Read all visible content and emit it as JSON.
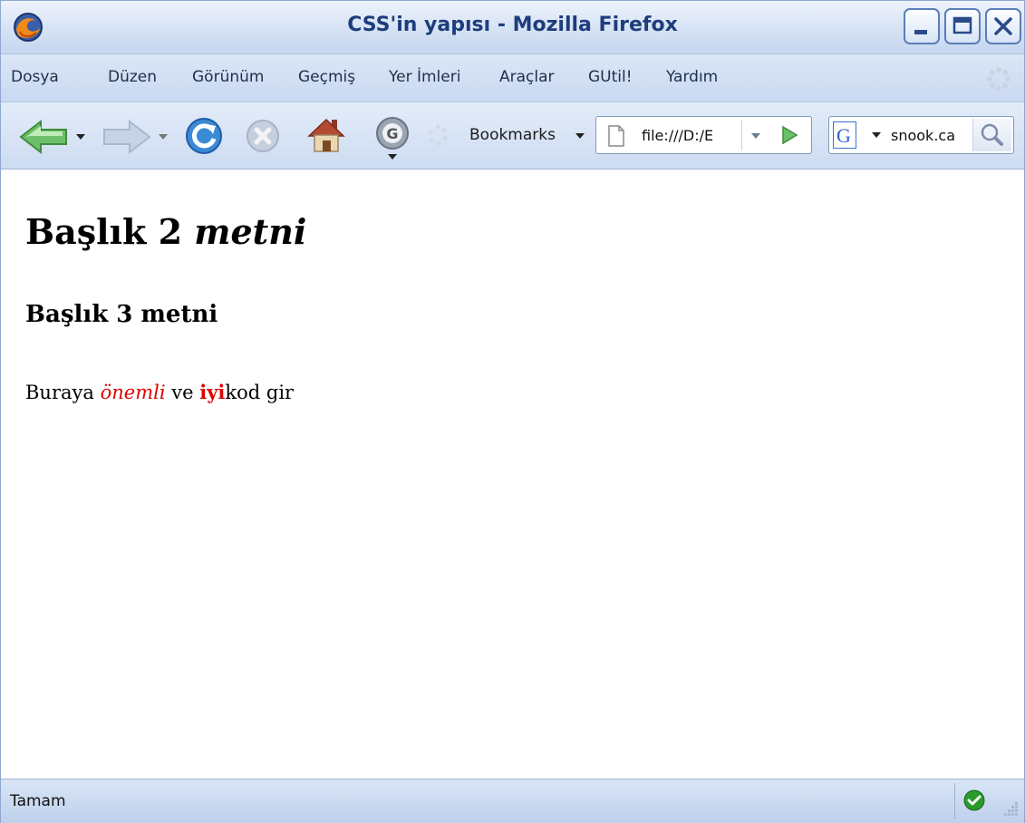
{
  "window": {
    "title": "CSS'in yapısı - Mozilla Firefox",
    "controls": [
      "minimize",
      "maximize",
      "close"
    ]
  },
  "menu": {
    "items": [
      {
        "label": "Dosya"
      },
      {
        "label": "Düzen"
      },
      {
        "label": "Görünüm"
      },
      {
        "label": "Geçmiş"
      },
      {
        "label": "Yer İmleri"
      },
      {
        "label": "Araçlar"
      },
      {
        "label": "GUtil!"
      },
      {
        "label": "Yardım"
      }
    ]
  },
  "toolbar": {
    "bookmarks_label": "Bookmarks",
    "url_value": "file:///D:/E",
    "search_value": "snook.ca",
    "search_engine": "G"
  },
  "content": {
    "heading2_plain": "Başlık 2",
    "heading2_italic": "metni",
    "heading3": "Başlık 3 metni",
    "para_prefix": "Buraya",
    "para_em": "önemli",
    "para_mid": "ve",
    "para_strong": "iyi",
    "para_suffix": "kod gir",
    "accent_color": "#e00000"
  },
  "status": {
    "text": "Tamam",
    "indicator": "ok-check-icon"
  }
}
